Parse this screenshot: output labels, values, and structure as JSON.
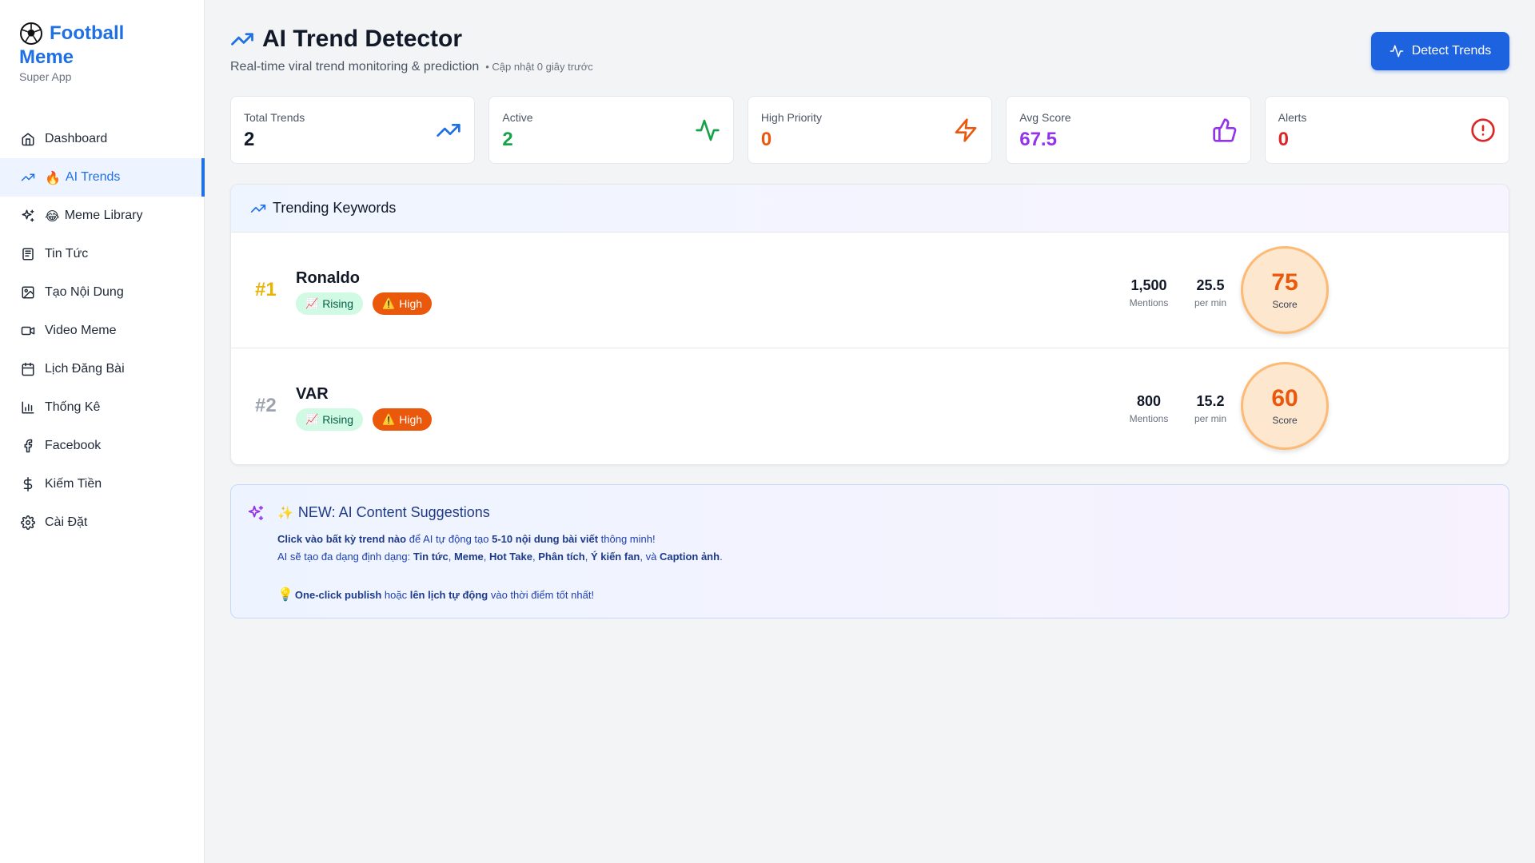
{
  "sidebar": {
    "brand_line1": "Football",
    "brand_line2": "Meme",
    "brand_sub": "Super App",
    "items": [
      {
        "label": "Dashboard",
        "emoji": ""
      },
      {
        "label": "AI Trends",
        "emoji": "🔥",
        "active": true
      },
      {
        "label": "Meme Library",
        "emoji": "😂"
      },
      {
        "label": "Tin Tức",
        "emoji": ""
      },
      {
        "label": "Tạo Nội Dung",
        "emoji": ""
      },
      {
        "label": "Video Meme",
        "emoji": ""
      },
      {
        "label": "Lịch Đăng Bài",
        "emoji": ""
      },
      {
        "label": "Thống Kê",
        "emoji": ""
      },
      {
        "label": "Facebook",
        "emoji": ""
      },
      {
        "label": "Kiếm Tiền",
        "emoji": ""
      },
      {
        "label": "Cài Đặt",
        "emoji": ""
      }
    ]
  },
  "header": {
    "title": "AI Trend Detector",
    "subtitle": "Real-time viral trend monitoring & prediction",
    "updated": "• Cập nhật 0 giây trước",
    "detect_button": "Detect Trends"
  },
  "stats": [
    {
      "label": "Total Trends",
      "value": "2",
      "color": "#111827",
      "icon": "trending-up-icon"
    },
    {
      "label": "Active",
      "value": "2",
      "color": "#16a34a",
      "icon": "activity-icon"
    },
    {
      "label": "High Priority",
      "value": "0",
      "color": "#ea580c",
      "icon": "zap-icon"
    },
    {
      "label": "Avg Score",
      "value": "67.5",
      "color": "#9333ea",
      "icon": "thumbs-up-icon"
    },
    {
      "label": "Alerts",
      "value": "0",
      "color": "#dc2626",
      "icon": "alert-circle-icon"
    }
  ],
  "trending": {
    "title": "Trending Keywords",
    "rows": [
      {
        "rank": "#1",
        "rank_color": "#eab308",
        "keyword": "Ronaldo",
        "status": "Rising",
        "priority": "High",
        "mentions": "1,500",
        "mentions_label": "Mentions",
        "rate": "25.5",
        "rate_label": "per min",
        "score": "75",
        "score_label": "Score"
      },
      {
        "rank": "#2",
        "rank_color": "#9ca3af",
        "keyword": "VAR",
        "status": "Rising",
        "priority": "High",
        "mentions": "800",
        "mentions_label": "Mentions",
        "rate": "15.2",
        "rate_label": "per min",
        "score": "60",
        "score_label": "Score"
      }
    ]
  },
  "suggestions": {
    "title": "NEW: AI Content Suggestions",
    "title_emoji": "✨",
    "line1_a": "Click vào bất kỳ trend nào",
    "line1_b": " để AI tự động tạo ",
    "line1_c": "5-10 nội dung bài viết",
    "line1_d": " thông minh!",
    "line2_a": "AI sẽ tạo đa dạng định dạng: ",
    "line2_f1": "Tin tức",
    "line2_f2": "Meme",
    "line2_f3": "Hot Take",
    "line2_f4": "Phân tích",
    "line2_f5": "Ý kiến fan",
    "line2_and": ", và ",
    "line2_f6": "Caption ảnh",
    "line2_end": ".",
    "line3_emoji": "💡",
    "line3_a": "One-click publish",
    "line3_b": " hoặc ",
    "line3_c": "lên lịch tự động",
    "line3_d": " vào thời điểm tốt nhất!"
  }
}
